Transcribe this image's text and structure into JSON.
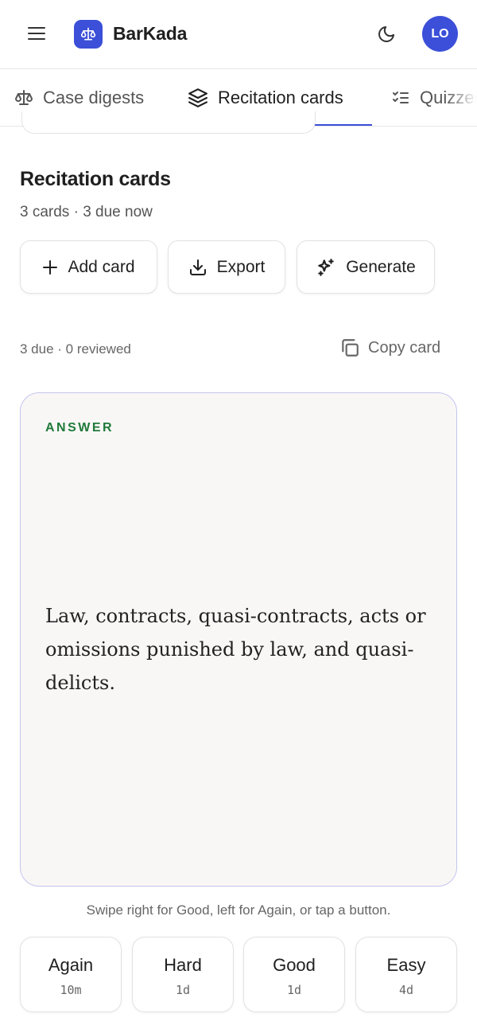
{
  "app": {
    "brand": "BarKada",
    "avatar_initials": "LO",
    "accent_color": "#3b4fd8"
  },
  "header": {
    "menu_icon": "hamburger-icon",
    "theme_icon": "moon-icon",
    "logo_icon": "scales-icon"
  },
  "tabs": [
    {
      "label": "Case digests",
      "icon": "scales-icon",
      "active": false
    },
    {
      "label": "Recitation cards",
      "icon": "layers-icon",
      "active": true
    },
    {
      "label": "Quizzes",
      "icon": "checklist-icon",
      "active": false
    }
  ],
  "section": {
    "title": "Recitation cards",
    "subtitle": "3 cards · 3 due now"
  },
  "actions": {
    "add_label": "Add card",
    "export_label": "Export",
    "generate_label": "Generate"
  },
  "review": {
    "status": "3 due · 0 reviewed",
    "copy_label": "Copy card"
  },
  "card": {
    "side_label": "ANSWER",
    "text": "Law, contracts, quasi-contracts, acts or omissions punished by law, and quasi-delicts.",
    "label_color": "#1f7a3a"
  },
  "hint": "Swipe right for Good, left for Again, or tap a button.",
  "ratings": [
    {
      "label": "Again",
      "interval": "10m"
    },
    {
      "label": "Hard",
      "interval": "1d"
    },
    {
      "label": "Good",
      "interval": "1d"
    },
    {
      "label": "Easy",
      "interval": "4d"
    }
  ]
}
